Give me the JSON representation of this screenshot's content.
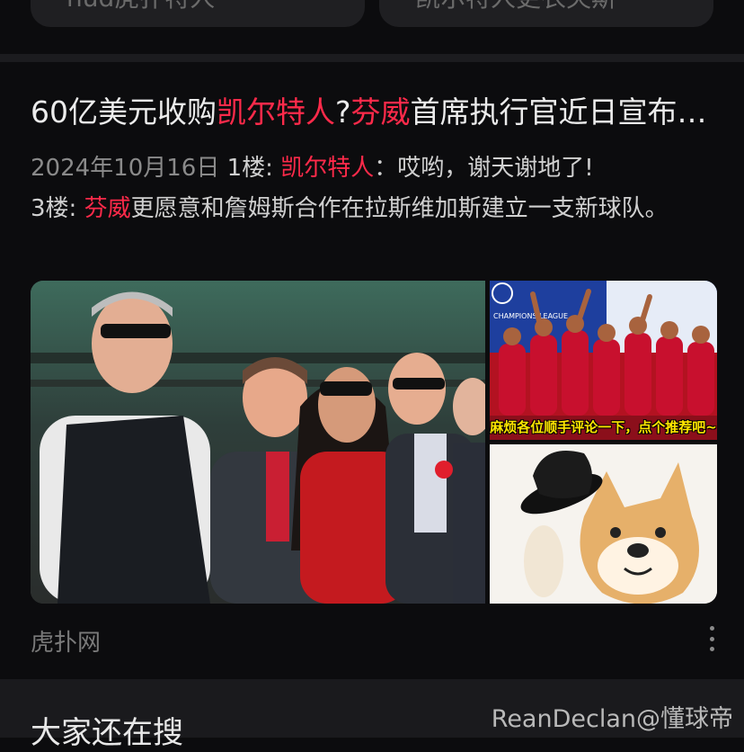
{
  "top_cards": [
    {
      "label": "hud虎扑特人"
    },
    {
      "label": "凯尔特人更衣失斯"
    }
  ],
  "article": {
    "title_parts": {
      "p1": "60亿美元收购",
      "p2": "凯尔特人",
      "p3": "?",
      "p4": "芬威",
      "p5": "首席执行官近日宣布……"
    },
    "snippet": {
      "date": "2024年10月16日",
      "floor1_label": "1楼:",
      "floor1_hl": "凯尔特人",
      "floor1_text": "：哎哟，谢天谢地了!",
      "floor3_label": "3楼:",
      "floor3_hl": "芬威",
      "floor3_text": "更愿意和詹姆斯合作在拉斯维加斯建立一支新球队。"
    },
    "images": {
      "main_alt": "owners-photo",
      "ucl_caption": "麻烦各位顺手评论一下，点个推荐吧~",
      "ucl_logo_text": "CHAMPIONS LEAGUE",
      "doge_alt": "doge-hat"
    },
    "source": "虎扑网"
  },
  "bottom": {
    "heading": "大家还在搜",
    "watermark": "ReanDeclan@懂球帝"
  },
  "colors": {
    "highlight": "#ff2a4a",
    "background": "#0c0c0e"
  }
}
